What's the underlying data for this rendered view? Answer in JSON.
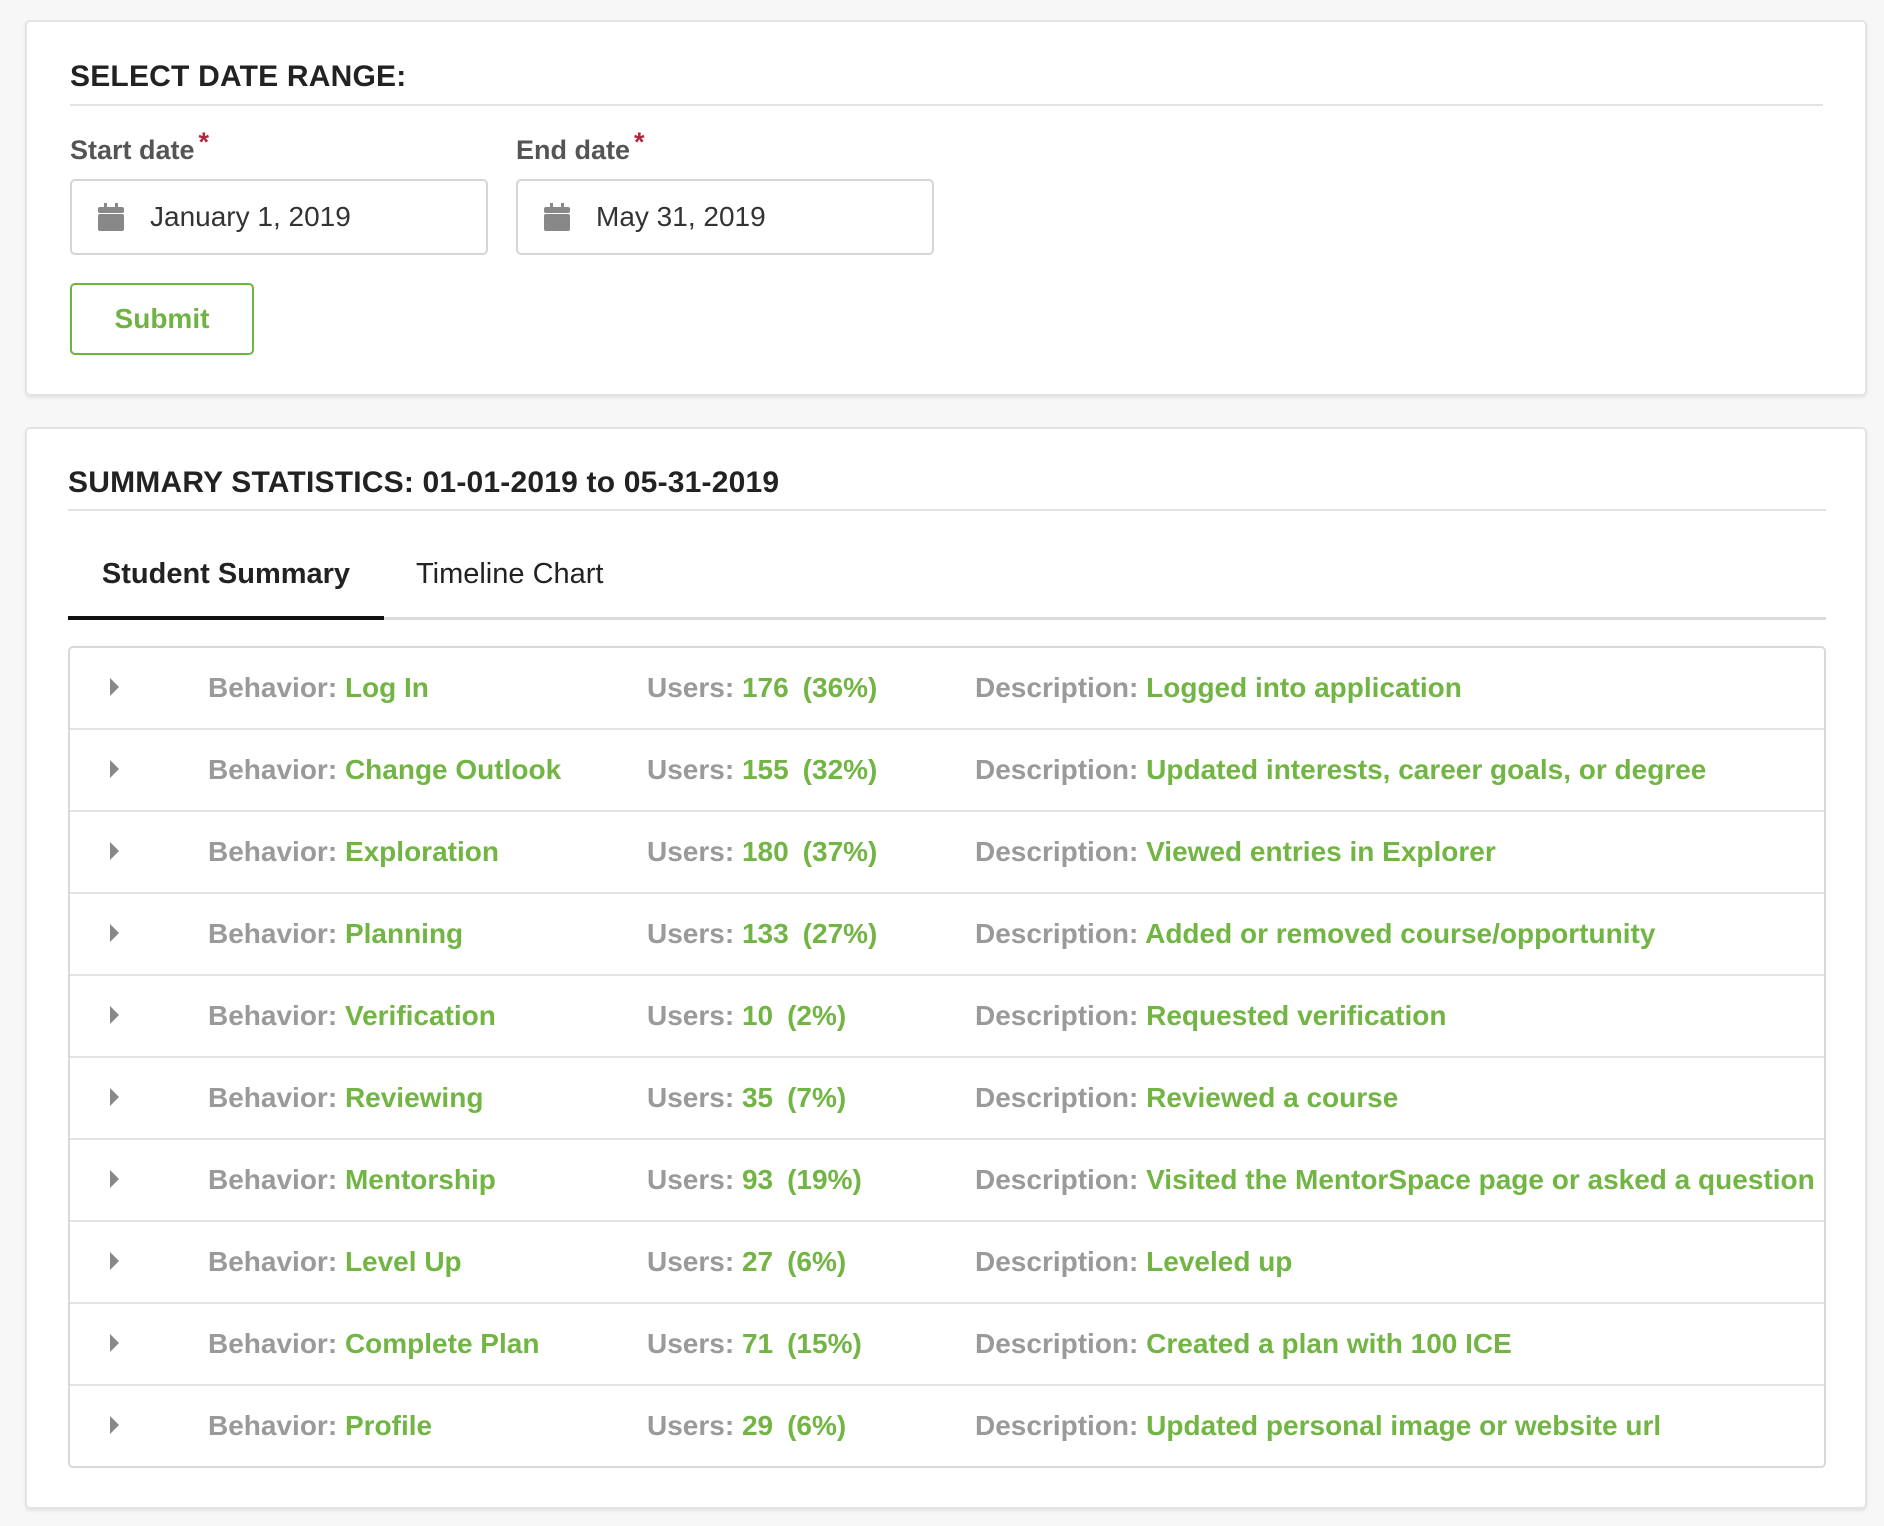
{
  "date_range": {
    "title": "SELECT DATE RANGE:",
    "start": {
      "label": "Start date",
      "required_mark": "*",
      "value": "January 1, 2019",
      "icon": "calendar-icon"
    },
    "end": {
      "label": "End date",
      "required_mark": "*",
      "value": "May 31, 2019",
      "icon": "calendar-icon"
    },
    "submit_label": "Submit"
  },
  "summary": {
    "title": "SUMMARY STATISTICS: 01-01-2019 to 05-31-2019",
    "tabs": [
      {
        "label": "Student Summary",
        "active": true
      },
      {
        "label": "Timeline Chart",
        "active": false
      }
    ],
    "labels": {
      "behavior": "Behavior:",
      "users": "Users:",
      "description": "Description:"
    },
    "rows": [
      {
        "behavior": "Log In",
        "users": "176",
        "percent": "(36%)",
        "description": "Logged into application"
      },
      {
        "behavior": "Change Outlook",
        "users": "155",
        "percent": "(32%)",
        "description": "Updated interests, career goals, or degree"
      },
      {
        "behavior": "Exploration",
        "users": "180",
        "percent": "(37%)",
        "description": "Viewed entries in Explorer"
      },
      {
        "behavior": "Planning",
        "users": "133",
        "percent": "(27%)",
        "description": "Added or removed course/opportunity"
      },
      {
        "behavior": "Verification",
        "users": "10",
        "percent": "(2%)",
        "description": "Requested verification"
      },
      {
        "behavior": "Reviewing",
        "users": "35",
        "percent": "(7%)",
        "description": "Reviewed a course"
      },
      {
        "behavior": "Mentorship",
        "users": "93",
        "percent": "(19%)",
        "description": "Visited the MentorSpace page or asked a question"
      },
      {
        "behavior": "Level Up",
        "users": "27",
        "percent": "(6%)",
        "description": "Leveled up"
      },
      {
        "behavior": "Complete Plan",
        "users": "71",
        "percent": "(15%)",
        "description": "Created a plan with 100 ICE"
      },
      {
        "behavior": "Profile",
        "users": "29",
        "percent": "(6%)",
        "description": "Updated personal image or website url"
      }
    ]
  },
  "colors": {
    "accent": "#72b544",
    "required": "#b3263a",
    "label_gray": "#9a9a9a"
  }
}
